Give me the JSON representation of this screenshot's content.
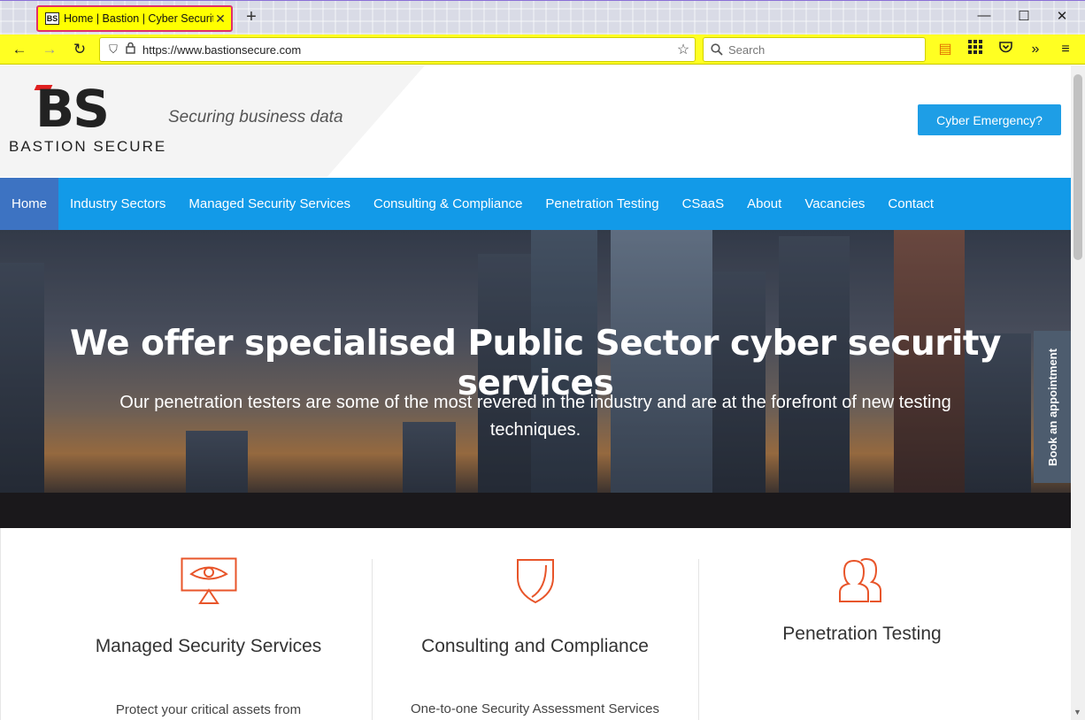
{
  "browser": {
    "tab_title": "Home | Bastion | Cyber Security",
    "tab_favicon": "BS",
    "url": "https://www.bastionsecure.com",
    "search_placeholder": "Search"
  },
  "header": {
    "logo_mark": "BS",
    "logo_name": "BASTION SECURE",
    "tagline": "Securing business data",
    "cta_label": "Cyber Emergency?"
  },
  "nav": {
    "items": [
      "Home",
      "Industry Sectors",
      "Managed Security Services",
      "Consulting & Compliance",
      "Penetration Testing",
      "CSaaS",
      "About",
      "Vacancies",
      "Contact"
    ]
  },
  "hero": {
    "title": "We offer specialised Public Sector cyber security services",
    "subtitle": "Our penetration testers are some of the most revered in the industry and are at the forefront of new testing techniques.",
    "appointment_label": "Book an appointment"
  },
  "services": [
    {
      "title": "Managed Security Services",
      "text": "Protect your critical assets from",
      "icon": "monitor-eye-icon"
    },
    {
      "title": "Consulting and Compliance",
      "text": "One-to-one Security Assessment Services",
      "icon": "shield-icon"
    },
    {
      "title": "Penetration Testing",
      "text": "",
      "icon": "users-icon"
    }
  ],
  "colors": {
    "nav_blue": "#129ae8",
    "nav_active": "#3d73c2",
    "accent_orange": "#e8552a",
    "cta_blue": "#1e9ee6"
  }
}
